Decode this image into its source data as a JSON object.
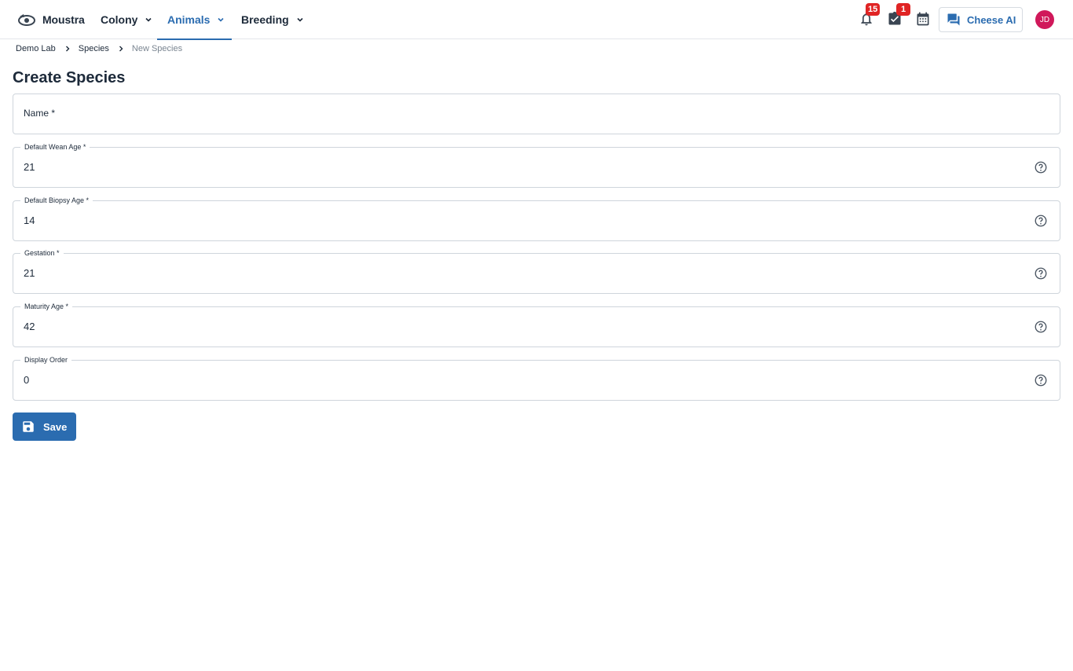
{
  "app": {
    "name": "Moustra"
  },
  "nav": {
    "items": [
      {
        "label": "Colony"
      },
      {
        "label": "Animals"
      },
      {
        "label": "Breeding"
      }
    ]
  },
  "header": {
    "notifications_count": "15",
    "tasks_count": "1",
    "ai_button_label": "Cheese AI",
    "avatar_initials": "JD"
  },
  "breadcrumb": [
    "Demo Lab",
    "Species",
    "New Species"
  ],
  "form": {
    "title": "Create Species",
    "fields": [
      {
        "label": "Name *",
        "value": ""
      },
      {
        "label": "Default Wean Age *",
        "value": "21"
      },
      {
        "label": "Default Biopsy Age *",
        "value": "14"
      },
      {
        "label": "Gestation *",
        "value": "21"
      },
      {
        "label": "Maturity Age *",
        "value": "42"
      },
      {
        "label": "Display Order",
        "value": "0"
      }
    ],
    "save_label": "Save"
  },
  "colors": {
    "accent": "#2b6cb0",
    "badge": "#e02424",
    "avatar": "#d0185a",
    "text": "#1d2a3a",
    "border": "#cfd5dc"
  }
}
